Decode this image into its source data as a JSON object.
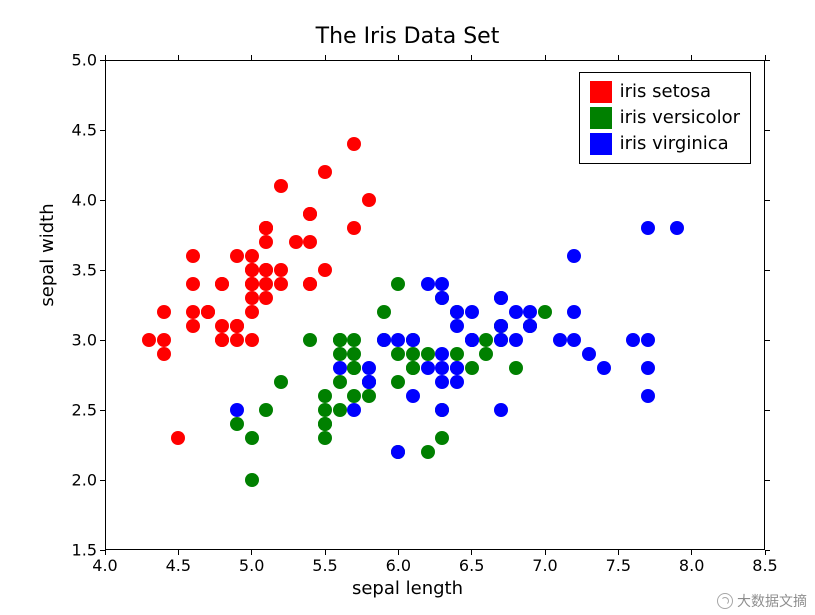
{
  "chart_data": {
    "type": "scatter",
    "title": "The Iris Data Set",
    "xlabel": "sepal length",
    "ylabel": "sepal width",
    "xlim": [
      4.0,
      8.5
    ],
    "ylim": [
      1.5,
      5.0
    ],
    "x_ticks": [
      4.0,
      4.5,
      5.0,
      5.5,
      6.0,
      6.5,
      7.0,
      7.5,
      8.0,
      8.5
    ],
    "y_ticks": [
      1.5,
      2.0,
      2.5,
      3.0,
      3.5,
      4.0,
      4.5,
      5.0
    ],
    "series": [
      {
        "name": "iris setosa",
        "color": "#ff0000",
        "x": [
          5.1,
          4.9,
          4.7,
          4.6,
          5.0,
          5.4,
          4.6,
          5.0,
          4.4,
          4.9,
          5.4,
          4.8,
          4.8,
          4.3,
          5.8,
          5.7,
          5.4,
          5.1,
          5.7,
          5.1,
          5.4,
          5.1,
          4.6,
          5.1,
          4.8,
          5.0,
          5.0,
          5.2,
          5.2,
          4.7,
          4.8,
          5.4,
          5.2,
          5.5,
          4.9,
          5.0,
          5.5,
          4.9,
          4.4,
          5.1,
          5.0,
          4.5,
          4.4,
          5.0,
          5.1,
          4.8,
          5.1,
          4.6,
          5.3,
          5.0
        ],
        "y": [
          3.5,
          3.0,
          3.2,
          3.1,
          3.6,
          3.9,
          3.4,
          3.4,
          2.9,
          3.1,
          3.7,
          3.4,
          3.0,
          3.0,
          4.0,
          4.4,
          3.9,
          3.5,
          3.8,
          3.8,
          3.4,
          3.7,
          3.6,
          3.3,
          3.4,
          3.0,
          3.4,
          3.5,
          3.4,
          3.2,
          3.1,
          3.4,
          4.1,
          4.2,
          3.1,
          3.2,
          3.5,
          3.6,
          3.0,
          3.4,
          3.5,
          2.3,
          3.2,
          3.5,
          3.8,
          3.0,
          3.8,
          3.2,
          3.7,
          3.3
        ]
      },
      {
        "name": "iris versicolor",
        "color": "#008000",
        "x": [
          7.0,
          6.4,
          6.9,
          5.5,
          6.5,
          5.7,
          6.3,
          4.9,
          6.6,
          5.2,
          5.0,
          5.9,
          6.0,
          6.1,
          5.6,
          6.7,
          5.6,
          5.8,
          6.2,
          5.6,
          5.9,
          6.1,
          6.3,
          6.1,
          6.4,
          6.6,
          6.8,
          6.7,
          6.0,
          5.7,
          5.5,
          5.5,
          5.8,
          6.0,
          5.4,
          6.0,
          6.7,
          6.3,
          5.6,
          5.5,
          5.5,
          6.1,
          5.8,
          5.0,
          5.6,
          5.7,
          5.7,
          6.2,
          5.1,
          5.7
        ],
        "y": [
          3.2,
          3.2,
          3.1,
          2.3,
          2.8,
          2.8,
          3.3,
          2.4,
          2.9,
          2.7,
          2.0,
          3.0,
          2.2,
          2.9,
          2.9,
          3.1,
          3.0,
          2.7,
          2.2,
          2.5,
          3.2,
          2.8,
          2.5,
          2.8,
          2.9,
          3.0,
          2.8,
          3.0,
          2.9,
          2.6,
          2.4,
          2.4,
          2.7,
          2.7,
          3.0,
          3.4,
          3.1,
          2.3,
          3.0,
          2.5,
          2.6,
          3.0,
          2.6,
          2.3,
          2.7,
          3.0,
          2.9,
          2.9,
          2.5,
          2.8
        ]
      },
      {
        "name": "iris virginica",
        "color": "#0000ff",
        "x": [
          6.3,
          5.8,
          7.1,
          6.3,
          6.5,
          7.6,
          4.9,
          7.3,
          6.7,
          7.2,
          6.5,
          6.4,
          6.8,
          5.7,
          5.8,
          6.4,
          6.5,
          7.7,
          7.7,
          6.0,
          6.9,
          5.6,
          7.7,
          6.3,
          6.7,
          7.2,
          6.2,
          6.1,
          6.4,
          7.2,
          7.4,
          7.9,
          6.4,
          6.3,
          6.1,
          7.7,
          6.3,
          6.4,
          6.0,
          6.9,
          6.7,
          6.9,
          5.8,
          6.8,
          6.7,
          6.7,
          6.3,
          6.5,
          6.2,
          5.9
        ],
        "y": [
          3.3,
          2.7,
          3.0,
          2.9,
          3.0,
          3.0,
          2.5,
          2.9,
          2.5,
          3.6,
          3.2,
          2.7,
          3.0,
          2.5,
          2.8,
          3.2,
          3.0,
          3.8,
          2.6,
          2.2,
          3.2,
          2.8,
          2.8,
          2.7,
          3.3,
          3.2,
          2.8,
          3.0,
          2.8,
          3.0,
          2.8,
          3.8,
          2.8,
          2.8,
          2.6,
          3.0,
          3.4,
          3.1,
          3.0,
          3.1,
          3.1,
          3.1,
          2.7,
          3.2,
          3.3,
          3.0,
          2.5,
          3.0,
          3.4,
          3.0
        ]
      }
    ]
  },
  "watermark": "大数据文摘"
}
